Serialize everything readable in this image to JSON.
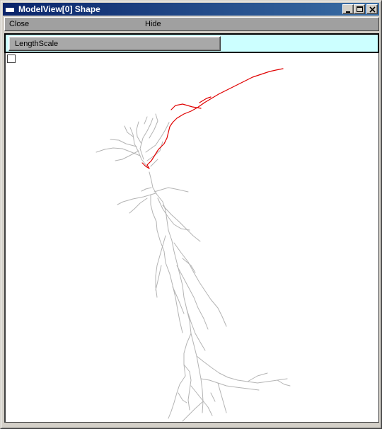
{
  "window": {
    "title": "ModelView[0] Shape"
  },
  "title_buttons": {
    "minimize": "minimize-icon",
    "maximize": "maximize-icon",
    "close": "close-icon"
  },
  "menu": {
    "close_label": "Close",
    "hide_label": "Hide"
  },
  "toolbar": {
    "length_scale_label": "LengthScale",
    "background_color": "#ccffff"
  },
  "canvas": {
    "checkbox_checked": false,
    "dendrite_color": "#b4b4b4",
    "axon_color": "#e00000"
  }
}
